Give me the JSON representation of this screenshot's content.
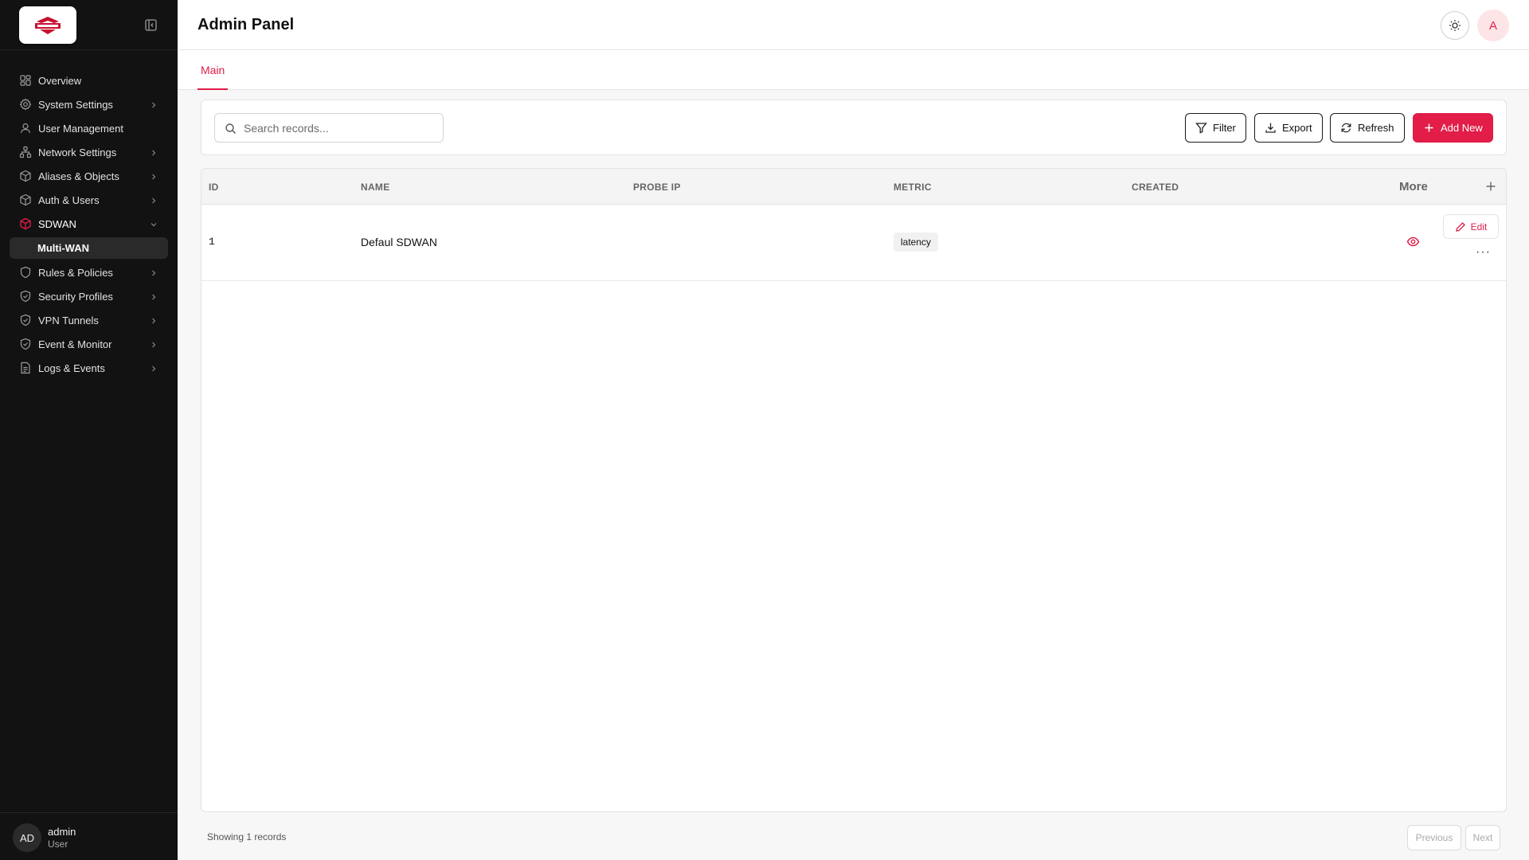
{
  "header": {
    "title": "Admin Panel",
    "avatar_initial": "A"
  },
  "tabs": [
    {
      "label": "Main",
      "active": true
    }
  ],
  "sidebar": {
    "items": [
      {
        "label": "Overview",
        "icon": "grid-icon",
        "expandable": false
      },
      {
        "label": "System Settings",
        "icon": "gear-icon",
        "expandable": true
      },
      {
        "label": "User Management",
        "icon": "user-icon",
        "expandable": false
      },
      {
        "label": "Network Settings",
        "icon": "network-icon",
        "expandable": true
      },
      {
        "label": "Aliases & Objects",
        "icon": "box-icon",
        "expandable": true
      },
      {
        "label": "Auth & Users",
        "icon": "box-icon",
        "expandable": true
      },
      {
        "label": "SDWAN",
        "icon": "box-icon",
        "expandable": true,
        "expanded": true
      },
      {
        "label": "Rules & Policies",
        "icon": "shield-icon",
        "expandable": true
      },
      {
        "label": "Security Profiles",
        "icon": "shield-check-icon",
        "expandable": true
      },
      {
        "label": "VPN Tunnels",
        "icon": "shield-check-icon",
        "expandable": true
      },
      {
        "label": "Event & Monitor",
        "icon": "shield-check-icon",
        "expandable": true
      },
      {
        "label": "Logs & Events",
        "icon": "file-icon",
        "expandable": true
      }
    ],
    "sub_item": "Multi-WAN",
    "user": {
      "initials": "AD",
      "name": "admin",
      "role": "User"
    }
  },
  "toolbar": {
    "search_placeholder": "Search records...",
    "filter_label": "Filter",
    "export_label": "Export",
    "refresh_label": "Refresh",
    "add_label": "Add New"
  },
  "table": {
    "columns": [
      "ID",
      "NAME",
      "PROBE IP",
      "METRIC",
      "CREATED"
    ],
    "more_label": "More",
    "rows": [
      {
        "id": "1",
        "name": "Defaul SDWAN",
        "probe_ip": "",
        "metric": "latency",
        "created": ""
      }
    ],
    "edit_label": "Edit"
  },
  "footer": {
    "status": "Showing 1 records",
    "previous_label": "Previous",
    "next_label": "Next"
  },
  "colors": {
    "accent": "#e11d48",
    "sidebar_bg": "#121212"
  }
}
